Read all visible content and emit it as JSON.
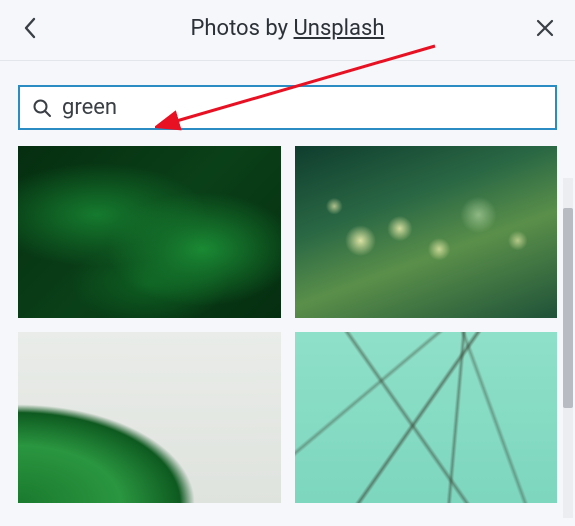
{
  "header": {
    "title_prefix": "Photos by ",
    "provider": "Unsplash"
  },
  "search": {
    "value": "green",
    "placeholder": ""
  },
  "icons": {
    "back": "chevron-left-icon",
    "close": "close-icon",
    "search": "search-icon"
  },
  "results": [
    {
      "alt": "dark green fern leaves"
    },
    {
      "alt": "green bokeh lights on grass"
    },
    {
      "alt": "monstera leaf on light background"
    },
    {
      "alt": "thin vines on mint wall"
    }
  ],
  "annotation": {
    "type": "arrow",
    "color": "#e81123"
  }
}
